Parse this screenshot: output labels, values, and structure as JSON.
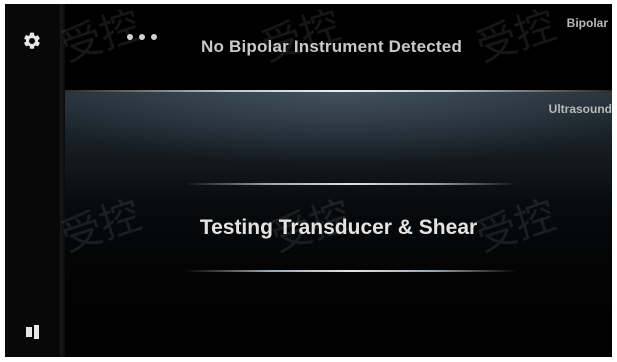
{
  "bipolar": {
    "section_label": "Bipolar",
    "status_text": "No Bipolar Instrument Detected",
    "menu_icon": "more-dots-icon"
  },
  "ultrasound": {
    "section_label": "Ultrasound",
    "status_text": "Testing Transducer & Shear"
  },
  "sidebar": {
    "settings_icon": "gear-icon",
    "volume_icon": "speaker-icon"
  },
  "watermark_text": "受控",
  "colors": {
    "background": "#030303",
    "label": "#b9b9b9",
    "status_text": "#e3e3e3"
  }
}
